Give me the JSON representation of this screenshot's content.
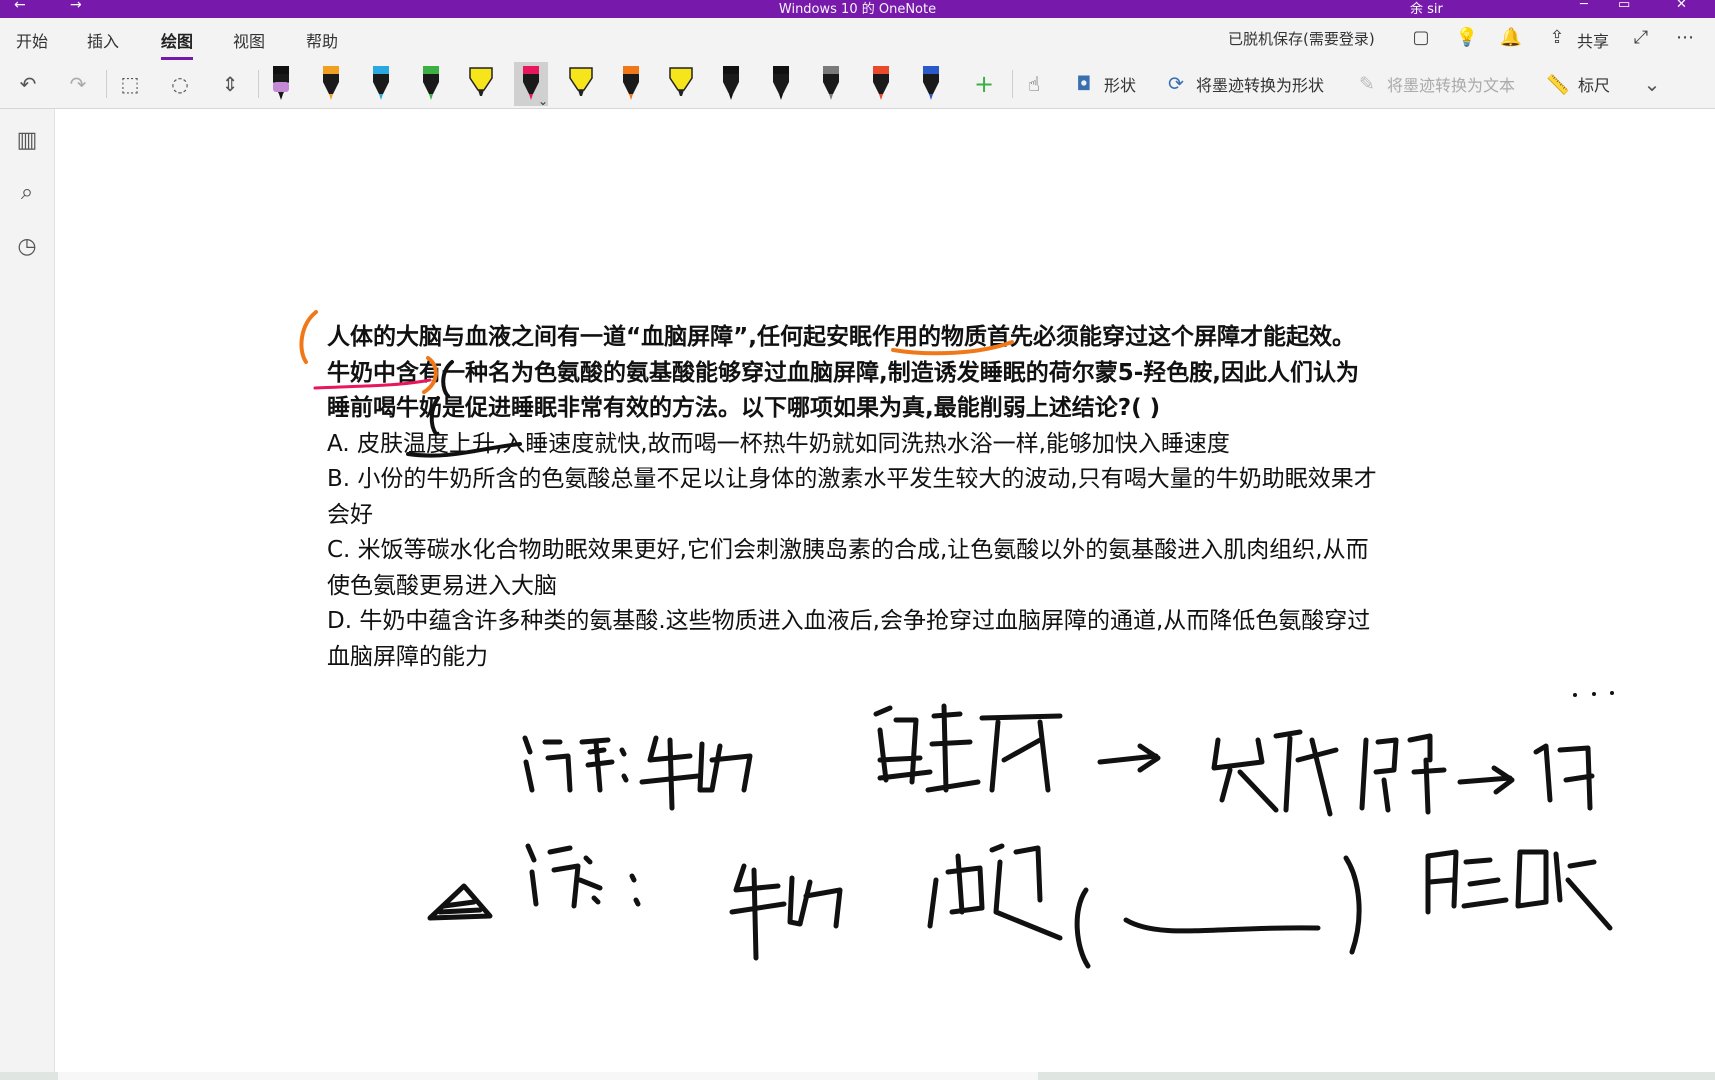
{
  "titlebar": {
    "title": "Windows 10 的 OneNote",
    "user": "余 sir",
    "back": "←",
    "forward": "→",
    "minimize": "─",
    "restore": "▭",
    "close": "✕"
  },
  "menu": {
    "tabs": [
      "开始",
      "插入",
      "绘图",
      "视图",
      "帮助"
    ],
    "active_tab": "绘图",
    "status": "已脱机保存(需要登录)",
    "share": "共享"
  },
  "ribbon": {
    "shapes": "形状",
    "ink_to_shape": "将墨迹转换为形状",
    "ink_to_text": "将墨迹转换为文本",
    "ruler": "标尺",
    "pens": [
      {
        "color": "#111111",
        "kind": "pen",
        "band": "#c58ad6"
      },
      {
        "color": "#f0a020",
        "kind": "pen"
      },
      {
        "color": "#2aa8e0",
        "kind": "pen"
      },
      {
        "color": "#3cb043",
        "kind": "pen"
      },
      {
        "color": "#f7e51b",
        "kind": "highlighter"
      },
      {
        "color": "#e8175d",
        "kind": "pen",
        "selected": true
      },
      {
        "color": "#f7e51b",
        "kind": "highlighter"
      },
      {
        "color": "#f07818",
        "kind": "pen"
      },
      {
        "color": "#f7e51b",
        "kind": "highlighter"
      },
      {
        "color": "#111111",
        "kind": "pen"
      },
      {
        "color": "#111111",
        "kind": "pen"
      },
      {
        "color": "#7a7a7a",
        "kind": "pen"
      },
      {
        "color": "#e84a2a",
        "kind": "pen"
      },
      {
        "color": "#2a5ac8",
        "kind": "pen"
      }
    ]
  },
  "question": {
    "stem": "人体的大脑与血液之间有一道“血脑屏障”,任何起安眠作用的物质首先必须能穿过这个屏障才能起效。牛奶中含有一种名为色氨酸的氨基酸能够穿过血脑屏障,制造诱发睡眠的荷尔蒙5-羟色胺,因此人们认为睡前喝牛奶是促进睡眠非常有效的方法。以下哪项如果为真,最能削弱上述结论?( )",
    "options": [
      "A.  皮肤温度上升,入睡速度就快,故而喝一杯热牛奶就如同洗热水浴一样,能够加快入睡速度",
      "B.  小份的牛奶所含的色氨酸总量不足以让身体的激素水平发生较大的波动,只有喝大量的牛奶助眠效果才会好",
      "C.  米饭等碳水化合物助眠效果更好,它们会刺激胰岛素的合成,让色氨酸以外的氨基酸进入肌肉组织,从而使色氨酸更易进入大脑",
      "D.  牛奶中蕴含许多种类的氨基酸.这些物质进入血液后,会争抢穿过血脑屏障的通道,从而降低色氨酸穿过血脑屏障的能力"
    ]
  }
}
